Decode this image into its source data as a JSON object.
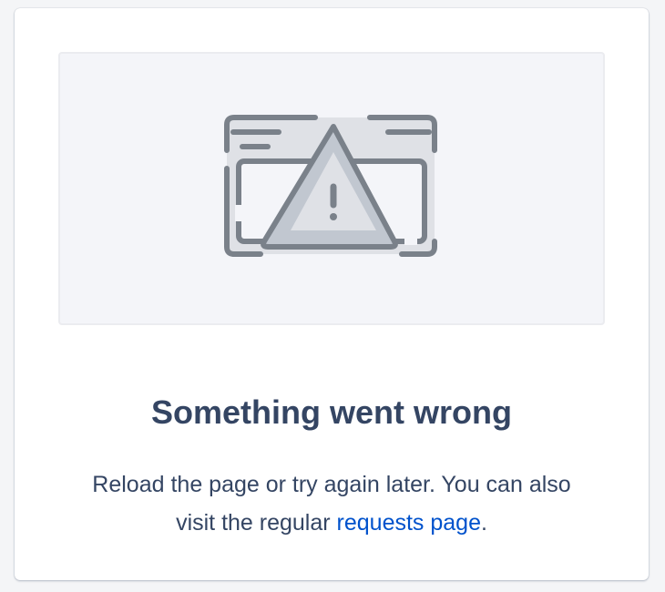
{
  "error": {
    "title": "Something went wrong",
    "message_before": "Reload the page or try again later. You can also visit the regular ",
    "link_text": "requests page",
    "message_after": "."
  },
  "illustration": {
    "icon": "browser-warning-illustration",
    "colors": {
      "stroke": "#7a818a",
      "fill": "#dfe1e6",
      "background": "#f4f5f9"
    }
  },
  "colors": {
    "heading": "#344563",
    "text": "#344563",
    "link": "#0052cc"
  }
}
